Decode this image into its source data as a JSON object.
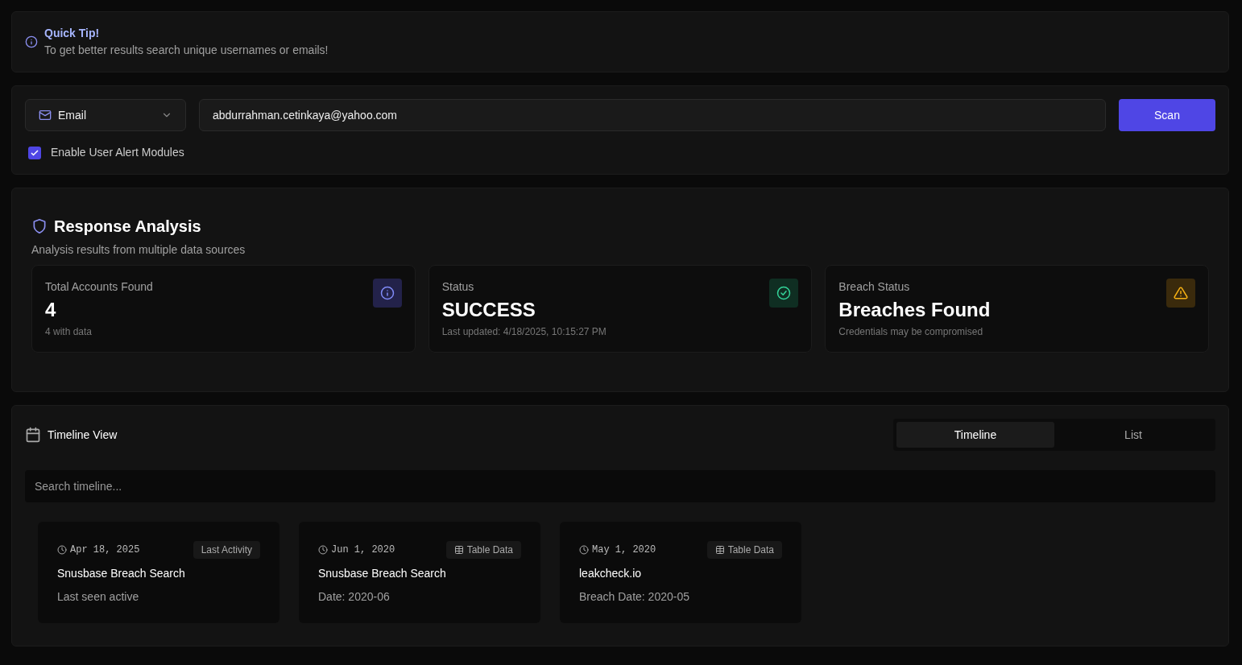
{
  "tip": {
    "title": "Quick Tip!",
    "text": "To get better results search unique usernames or emails!"
  },
  "search": {
    "type": "Email",
    "value": "abdurrahman.cetinkaya@yahoo.com",
    "button": "Scan",
    "alerts": {
      "label": "Enable User Alert Modules",
      "checked": true
    }
  },
  "analysis": {
    "title": "Response Analysis",
    "subtitle": "Analysis results from multiple data sources",
    "stats": [
      {
        "kind": "info",
        "label": "Total Accounts Found",
        "value": "4",
        "note": "4 with data"
      },
      {
        "kind": "success",
        "label": "Status",
        "value": "SUCCESS",
        "note": "Last updated: 4/18/2025, 10:15:27 PM"
      },
      {
        "kind": "warning",
        "label": "Breach Status",
        "value": "Breaches Found",
        "note": "Credentials may be compromised"
      }
    ]
  },
  "timeline": {
    "title": "Timeline View",
    "tabs": [
      {
        "label": "Timeline",
        "selected": true
      },
      {
        "label": "List",
        "selected": false
      }
    ],
    "placeholder": "Search timeline...",
    "events": [
      {
        "date": "Apr 18, 2025",
        "tag": "Last Activity",
        "kind": "activity",
        "title": "Snusbase Breach Search",
        "detail": "Last seen active"
      },
      {
        "date": "Jun 1, 2020",
        "tag": "Table Data",
        "kind": "table",
        "title": "Snusbase Breach Search",
        "detail": "Date: 2020-06"
      },
      {
        "date": "May 1, 2020",
        "tag": "Table Data",
        "kind": "table",
        "title": "leakcheck.io",
        "detail": "Breach Date: 2020-05"
      }
    ]
  }
}
